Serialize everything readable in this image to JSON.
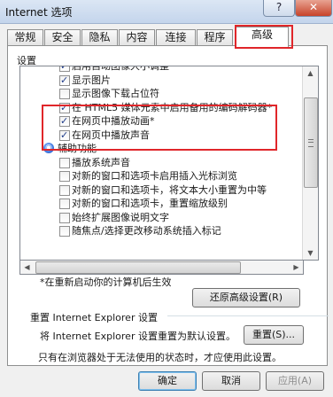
{
  "window": {
    "title": "Internet 选项",
    "help_label": "?",
    "close_label": "✕"
  },
  "tabs": [
    "常规",
    "安全",
    "隐私",
    "内容",
    "连接",
    "程序",
    "高级"
  ],
  "section_label": "设置",
  "settings_list": [
    {
      "type": "checkbox",
      "checked": true,
      "label": "启用自动图像大小调整"
    },
    {
      "type": "checkbox",
      "checked": true,
      "label": "显示图片"
    },
    {
      "type": "checkbox",
      "checked": false,
      "label": "显示图像下载占位符"
    },
    {
      "type": "checkbox",
      "checked": true,
      "label": "在 HTML5 媒体元素中启用备用的编码解码器*"
    },
    {
      "type": "checkbox",
      "checked": true,
      "label": "在网页中播放动画*"
    },
    {
      "type": "checkbox",
      "checked": true,
      "label": "在网页中播放声音"
    },
    {
      "type": "category",
      "label": "辅助功能"
    },
    {
      "type": "checkbox",
      "checked": false,
      "label": "播放系统声音"
    },
    {
      "type": "checkbox",
      "checked": false,
      "label": "对新的窗口和选项卡启用插入光标浏览"
    },
    {
      "type": "checkbox",
      "checked": false,
      "label": "对新的窗口和选项卡，将文本大小重置为中等"
    },
    {
      "type": "checkbox",
      "checked": false,
      "label": "对新的窗口和选项卡，重置缩放级别"
    },
    {
      "type": "checkbox",
      "checked": false,
      "label": "始终扩展图像说明文字"
    },
    {
      "type": "checkbox",
      "checked": false,
      "label": "随焦点/选择更改移动系统插入标记"
    }
  ],
  "restart_note": "*在重新启动你的计算机后生效",
  "restore_button": "还原高级设置(R)",
  "reset_group": {
    "label": "重置 Internet Explorer 设置",
    "description": "将 Internet Explorer 设置重置为默认设置。",
    "button": "重置(S)...",
    "footer": "只有在浏览器处于无法使用的状态时，才应使用此设置。"
  },
  "buttons": {
    "ok": "确定",
    "cancel": "取消",
    "apply": "应用(A)"
  },
  "colors": {
    "highlight": "#e0262a"
  }
}
